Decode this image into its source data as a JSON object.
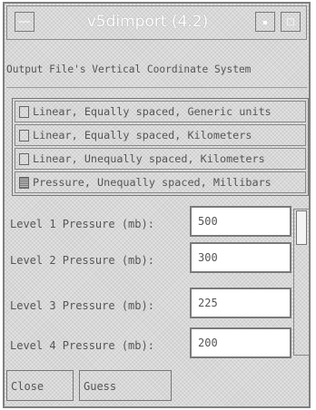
{
  "window": {
    "title": "v5dimport (4.2)"
  },
  "vertical_system": {
    "heading": "Output File's Vertical Coordinate System",
    "options": [
      {
        "label": "Linear, Equally spaced, Generic units",
        "selected": false
      },
      {
        "label": "Linear, Equally spaced, Kilometers",
        "selected": false
      },
      {
        "label": "Linear, Unequally spaced, Kilometers",
        "selected": false
      },
      {
        "label": "Pressure, Unequally spaced, Millibars",
        "selected": true
      }
    ]
  },
  "levels": [
    {
      "label": "Level 1 Pressure (mb):",
      "value": "500"
    },
    {
      "label": "Level 2 Pressure (mb):",
      "value": "300"
    },
    {
      "label": "Level 3 Pressure (mb):",
      "value": "225"
    },
    {
      "label": "Level 4 Pressure (mb):",
      "value": "200"
    }
  ],
  "buttons": {
    "close": "Close",
    "guess": "Guess"
  }
}
